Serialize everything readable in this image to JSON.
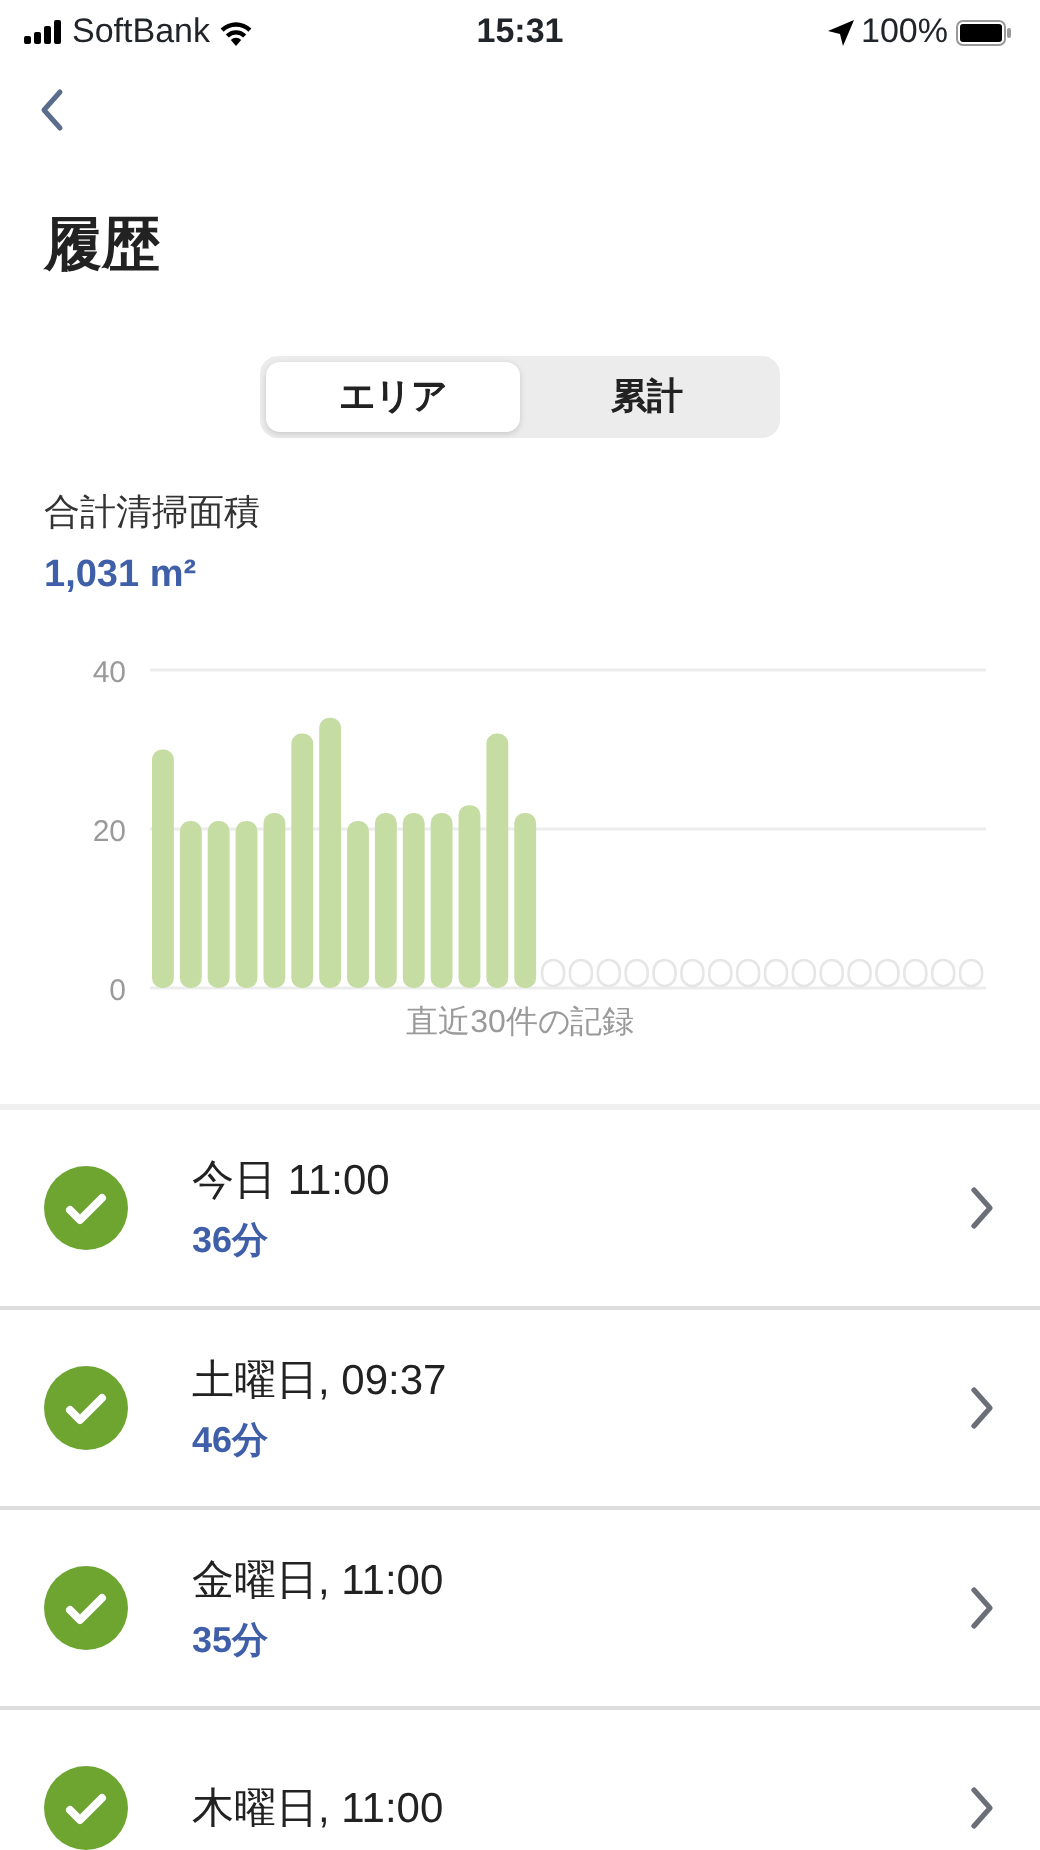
{
  "status_bar": {
    "carrier": "SoftBank",
    "time": "15:31",
    "battery": "100%"
  },
  "title": "履歴",
  "tabs": [
    {
      "label": "エリア",
      "selected": true
    },
    {
      "label": "累計",
      "selected": false
    }
  ],
  "summary": {
    "label": "合計清掃面積",
    "value": "1,031 m²"
  },
  "chart_data": {
    "type": "bar",
    "xlabel": "直近30件の記録",
    "series": [
      {
        "color": "#c5dda3",
        "values": [
          30,
          21,
          21,
          21,
          22,
          32,
          34,
          21,
          22,
          22,
          22,
          23,
          32,
          22,
          null,
          null,
          null,
          null,
          null,
          null,
          null,
          null,
          null,
          null,
          null,
          null,
          null,
          null,
          null,
          null
        ]
      }
    ],
    "ylim": [
      0,
      40
    ],
    "yticks": [
      0,
      20,
      40
    ]
  },
  "records": [
    {
      "title": "今日 11:00",
      "duration": "36分"
    },
    {
      "title": "土曜日, 09:37",
      "duration": "46分"
    },
    {
      "title": "金曜日, 11:00",
      "duration": "35分"
    },
    {
      "title": "木曜日, 11:00"
    }
  ]
}
